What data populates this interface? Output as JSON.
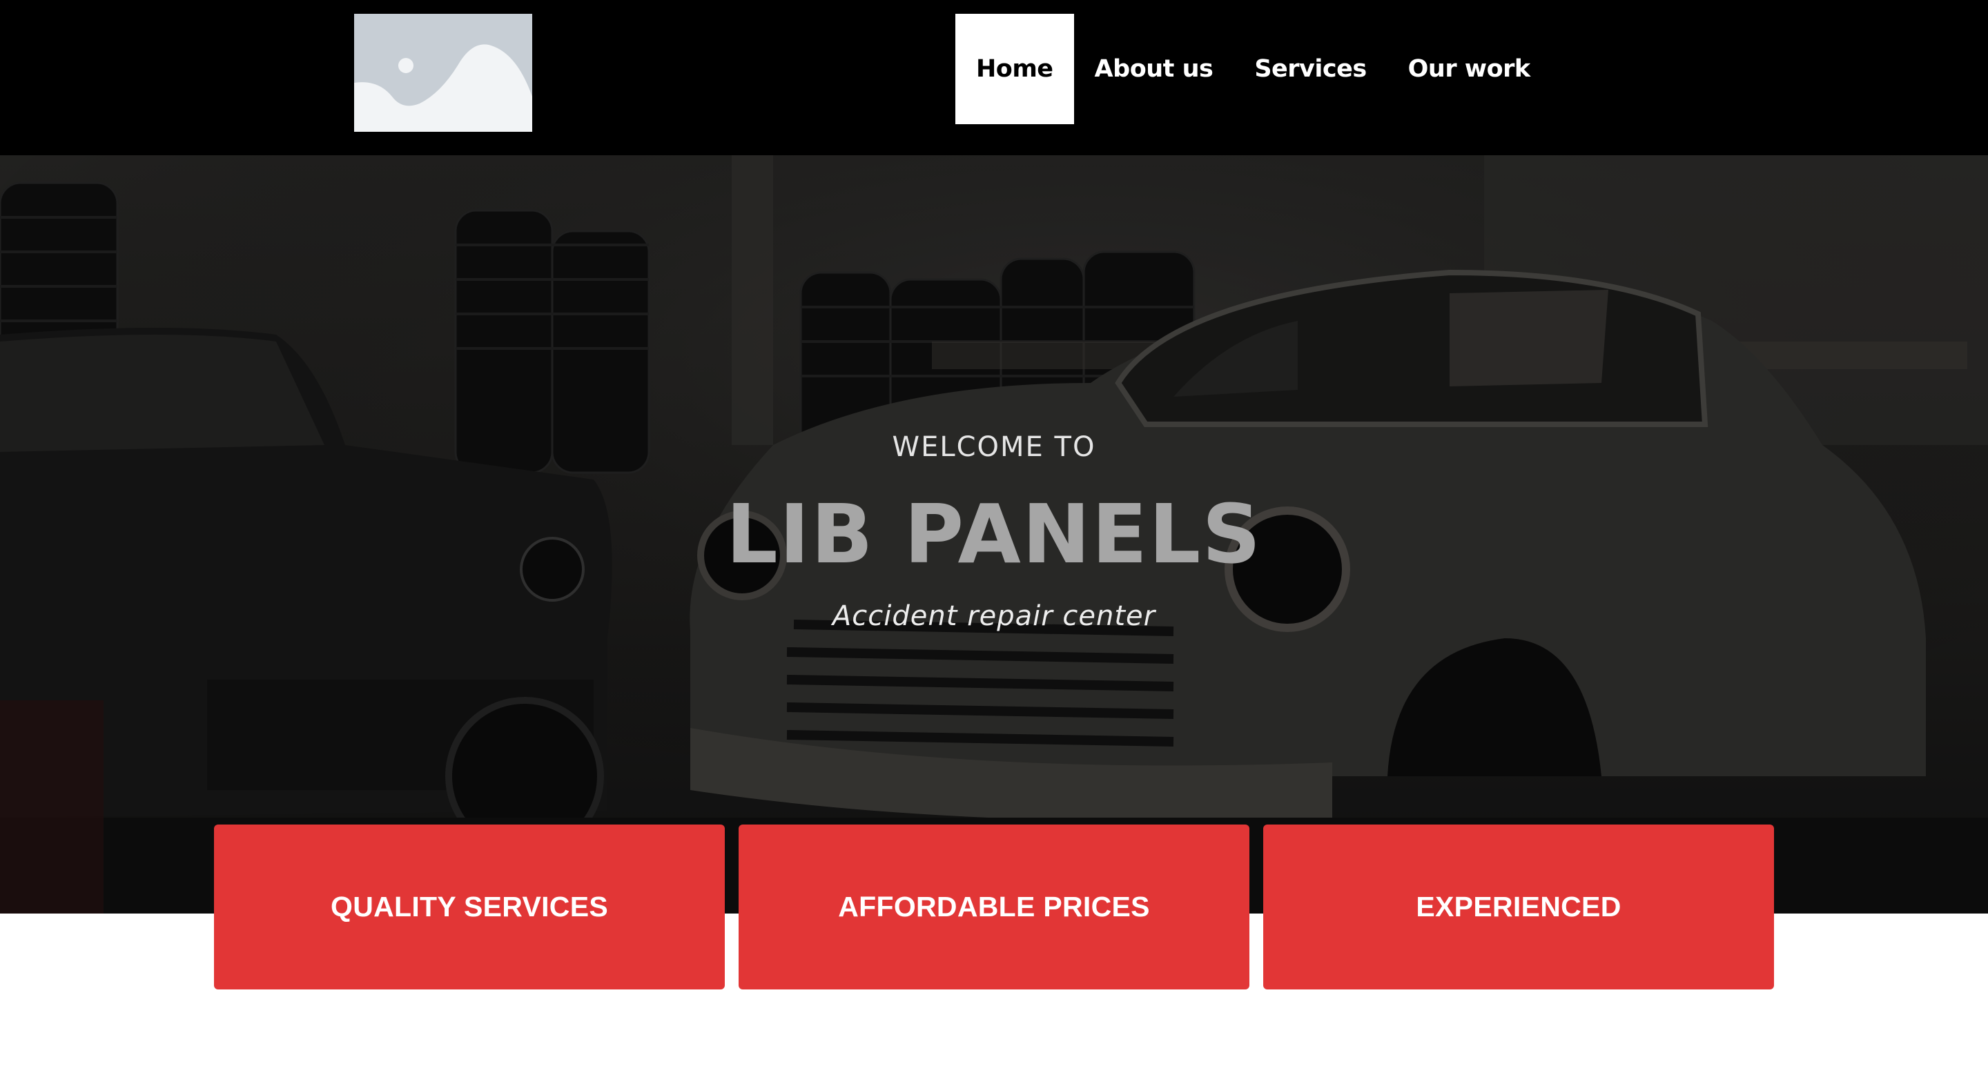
{
  "header": {
    "logo_icon": "image-placeholder-icon",
    "nav": [
      {
        "label": "Home",
        "active": true
      },
      {
        "label": "About us",
        "active": false
      },
      {
        "label": "Services",
        "active": false
      },
      {
        "label": "Our work",
        "active": false
      }
    ]
  },
  "hero": {
    "welcome": "WELCOME TO",
    "title": "LIB PANELS",
    "tagline": "Accident repair center",
    "background_image": "garage-classic-car-photo"
  },
  "features": [
    {
      "label": "QUALITY SERVICES"
    },
    {
      "label": "AFFORDABLE PRICES"
    },
    {
      "label": "EXPERIENCED"
    }
  ],
  "colors": {
    "header_bg": "#000000",
    "nav_active_bg": "#ffffff",
    "feature_bg": "#e23636",
    "hero_title": "#a6a6a6"
  }
}
